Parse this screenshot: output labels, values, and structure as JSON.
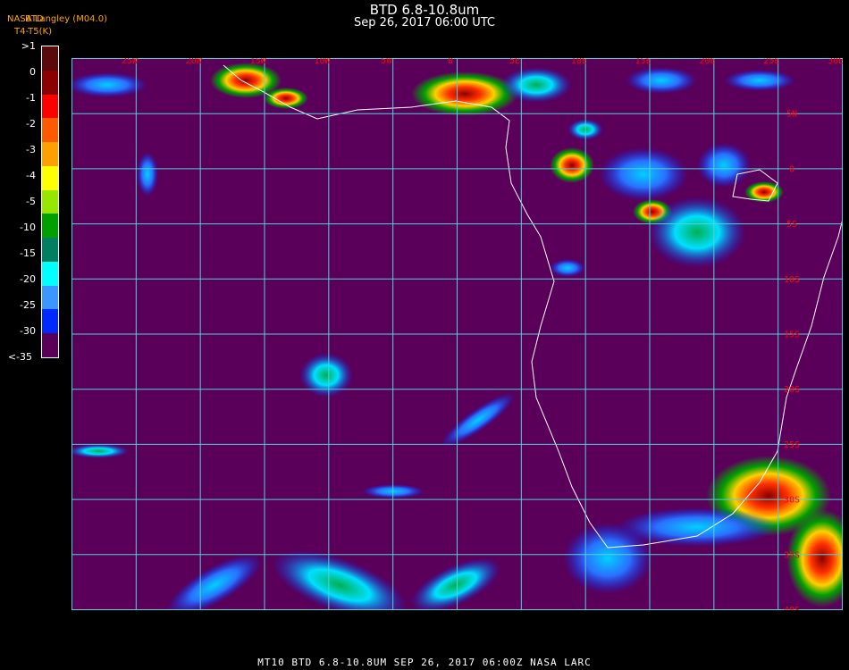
{
  "header": {
    "title": "BTD 6.8-10.8um",
    "subtitle": "Sep 26, 2017 06:00 UTC",
    "credit": "NASA Langley (M04.0)",
    "legend_unit": "T4-T5(K)",
    "legend_overlay": "BTD"
  },
  "legend": {
    "labels": [
      ">1",
      "0",
      "-1",
      "-2",
      "-3",
      "-4",
      "-5",
      "-10",
      "-15",
      "-20",
      "-25",
      "-30",
      "<-35"
    ],
    "colors": [
      "#5a0a0a",
      "#8b0000",
      "#ff0000",
      "#ff5a00",
      "#ffa000",
      "#ffff00",
      "#96e600",
      "#00a000",
      "#008060",
      "#00ffff",
      "#3c96ff",
      "#0028ff",
      "#5a005a"
    ]
  },
  "map": {
    "lon_labels": [
      "25W",
      "20W",
      "15W",
      "10W",
      "5W",
      "0",
      "5E",
      "10E",
      "15E",
      "20E",
      "25E",
      "30E",
      "35E"
    ],
    "lat_labels": [
      "5N",
      "0",
      "5S",
      "10S",
      "15S",
      "20S",
      "25S",
      "30S",
      "35S",
      "40S"
    ],
    "grid_color": "#4fd3d8",
    "label_color": "#ff0000",
    "background_color": "#5a005a"
  },
  "footer": {
    "text": "MT10   BTD 6.8-10.8UM    SEP 26, 2017 06:00Z   NASA LARC"
  }
}
